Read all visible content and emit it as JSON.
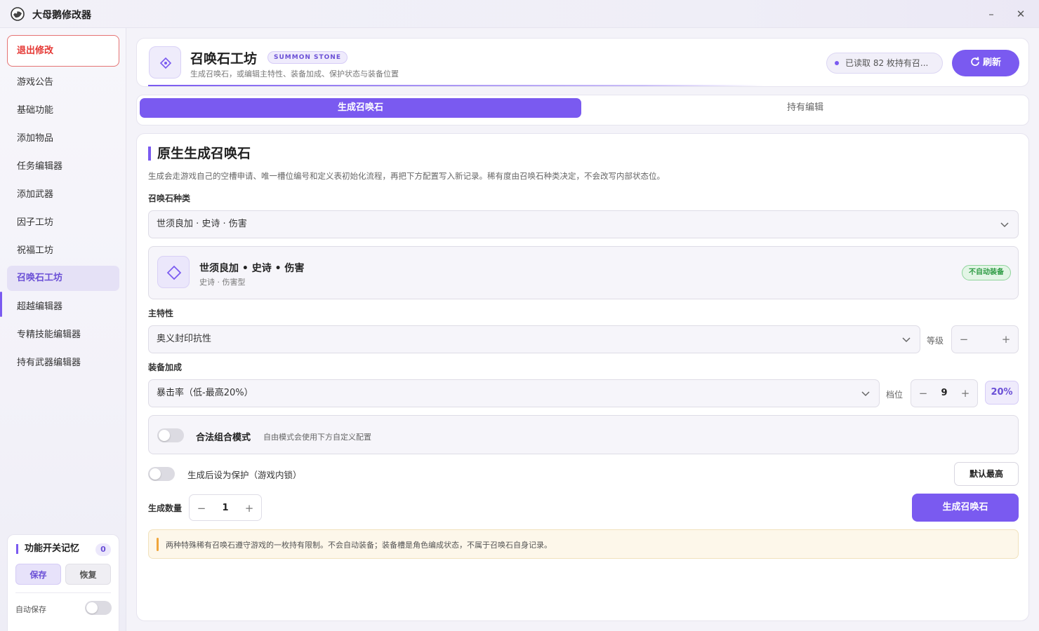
{
  "app": {
    "title": "大母鹅修改器"
  },
  "window": {
    "minimize": "–",
    "close": "✕"
  },
  "sidebar": {
    "exit_label": "退出修改",
    "items": [
      {
        "label": "游戏公告"
      },
      {
        "label": "基础功能"
      },
      {
        "label": "添加物品"
      },
      {
        "label": "任务编辑器"
      },
      {
        "label": "添加武器"
      },
      {
        "label": "因子工坊"
      },
      {
        "label": "祝福工坊"
      },
      {
        "label": "召唤石工坊",
        "active": true
      },
      {
        "label": "超越编辑器"
      },
      {
        "label": "专精技能编辑器"
      },
      {
        "label": "持有武器编辑器"
      }
    ],
    "memory": {
      "title": "功能开关记忆",
      "count": "0",
      "save_label": "保存",
      "restore_label": "恢复",
      "autosave_label": "自动保存",
      "autosave_on": false
    }
  },
  "header": {
    "title": "召唤石工坊",
    "tag": "SUMMON STONE",
    "subtitle": "生成召唤石，或编辑主特性、装备加成、保护状态与装备位置",
    "status": "已读取 82 枚持有召...",
    "refresh_label": "刷新"
  },
  "tabs": [
    {
      "label": "生成召唤石",
      "active": true
    },
    {
      "label": "持有编辑",
      "active": false
    }
  ],
  "main": {
    "section_title": "原生生成召唤石",
    "section_desc": "生成会走游戏自己的空槽申请、唯一槽位编号和定义表初始化流程，再把下方配置写入新记录。稀有度由召唤石种类决定，不会改写内部状态位。",
    "kind_label": "召唤石种类",
    "kind_value": "世须良加 · 史诗 · 伤害",
    "preview": {
      "name": "世须良加 • 史诗 • 伤害",
      "sub": "史诗 · 伤害型",
      "badge": "不自动装备"
    },
    "trait_label": "主特性",
    "trait_value": "奥义封印抗性",
    "level_label": "等级",
    "level_value": "",
    "bonus_label": "装备加成",
    "bonus_value": "暴击率（低-最高20%）",
    "tier_label": "档位",
    "tier_value": "9",
    "tier_percent": "20%",
    "combo_title": "合法组合模式",
    "combo_sub": "自由模式会使用下方自定义配置",
    "combo_on": false,
    "protect_label": "生成后设为保护（游戏内锁）",
    "protect_on": false,
    "default_btn": "默认最高",
    "qty_label": "生成数量",
    "qty_value": "1",
    "generate_btn": "生成召唤石",
    "notice": "两种特殊稀有召唤石遵守游戏的一枚持有限制。不会自动装备；装备槽是角色编成状态，不属于召唤石自身记录。"
  },
  "colors": {
    "accent": "#7a5af0",
    "danger": "#e53935",
    "success": "#2e9b44",
    "warning": "#f0a53a"
  },
  "icons": {
    "app_logo": "goose-logo-icon",
    "refresh": "refresh-icon",
    "header": "diamond-icon",
    "chevron": "chevron-down-icon"
  }
}
